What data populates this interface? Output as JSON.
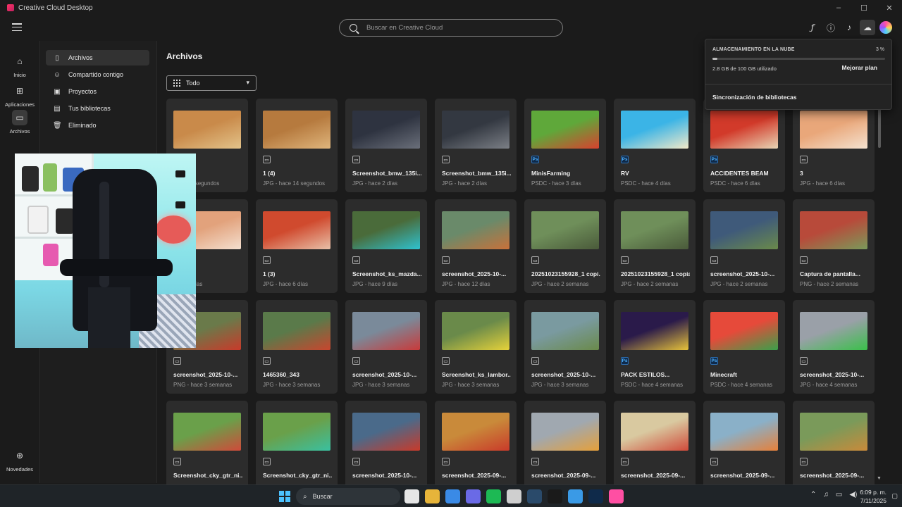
{
  "window": {
    "title": "Creative Cloud Desktop",
    "controls": [
      "minimize",
      "maximize",
      "close"
    ]
  },
  "search": {
    "placeholder": "Buscar en Creative Cloud"
  },
  "top_icons": [
    "fonts-icon",
    "help-icon",
    "bell-icon",
    "cloud-icon",
    "avatar"
  ],
  "rail": {
    "items": [
      {
        "label": "Inicio",
        "icon": "home-icon"
      },
      {
        "label": "Aplicaciones",
        "icon": "apps-icon"
      },
      {
        "label": "Archivos",
        "icon": "files-icon",
        "active": true
      },
      {
        "label": "Novedades",
        "icon": "gift-icon"
      }
    ]
  },
  "sidenav": {
    "items": [
      {
        "label": "Archivos",
        "icon": "file-icon",
        "active": true
      },
      {
        "label": "Compartido contigo",
        "icon": "people-icon"
      },
      {
        "label": "Proyectos",
        "icon": "project-icon"
      },
      {
        "label": "Tus bibliotecas",
        "icon": "library-icon"
      },
      {
        "label": "Eliminado",
        "icon": "trash-icon"
      }
    ]
  },
  "main": {
    "title": "Archivos",
    "filter_label": "Todo"
  },
  "files": [
    {
      "name": "",
      "meta": "hace 12 segundos",
      "type": "img",
      "colors": [
        "#c98a4a",
        "#e3c38a"
      ]
    },
    {
      "name": "1 (4)",
      "meta": "JPG - hace 14 segundos",
      "type": "img",
      "colors": [
        "#b67a3e",
        "#dfb57c"
      ]
    },
    {
      "name": "Screenshot_bmw_135i...",
      "meta": "JPG - hace 2 días",
      "type": "img",
      "colors": [
        "#2e3340",
        "#6a6f7a"
      ]
    },
    {
      "name": "Screenshot_bmw_135i...",
      "meta": "JPG - hace 2 días",
      "type": "img",
      "colors": [
        "#333841",
        "#7b7f86"
      ]
    },
    {
      "name": "MinisFarming",
      "meta": "PSDC - hace 3 días",
      "type": "ps",
      "colors": [
        "#5fa83a",
        "#d8412f"
      ]
    },
    {
      "name": "RV",
      "meta": "PSDC - hace 4 días",
      "type": "ps",
      "colors": [
        "#3bb4e6",
        "#f2e9c9"
      ]
    },
    {
      "name": "ACCIDENTES BEAM",
      "meta": "PSDC - hace 6 días",
      "type": "ps",
      "colors": [
        "#d23a2a",
        "#e7d5b5"
      ]
    },
    {
      "name": "3",
      "meta": "JPG - hace 6 días",
      "type": "img",
      "colors": [
        "#e9a77a",
        "#f5e2d0"
      ]
    },
    {
      "name": "",
      "meta": "hace 6 días",
      "type": "img",
      "colors": [
        "#e2a27c",
        "#f4dfcf"
      ]
    },
    {
      "name": "1 (3)",
      "meta": "JPG - hace 6 días",
      "type": "img",
      "colors": [
        "#d04a2e",
        "#e8c0a8"
      ]
    },
    {
      "name": "Screenshot_ks_mazda...",
      "meta": "JPG - hace 9 días",
      "type": "img",
      "colors": [
        "#4a6b3a",
        "#2fc2d0"
      ]
    },
    {
      "name": "screenshot_2025-10-...",
      "meta": "JPG - hace 12 días",
      "type": "img",
      "colors": [
        "#6a8a6a",
        "#c9713a"
      ]
    },
    {
      "name": "20251023155928_1 copi...",
      "meta": "JPG - hace 2 semanas",
      "type": "img",
      "colors": [
        "#6f8f5a",
        "#4a5a3a"
      ]
    },
    {
      "name": "20251023155928_1 copia",
      "meta": "JPG - hace 2 semanas",
      "type": "img",
      "colors": [
        "#6f8f5a",
        "#4a5a3a"
      ]
    },
    {
      "name": "screenshot_2025-10-...",
      "meta": "JPG - hace 2 semanas",
      "type": "img",
      "colors": [
        "#3f5a7a",
        "#6a8a4a"
      ]
    },
    {
      "name": "Captura de pantalla...",
      "meta": "PNG - hace 2 semanas",
      "type": "img",
      "colors": [
        "#b84a3a",
        "#7a9a5a"
      ]
    },
    {
      "name": "screenshot_2025-10-...",
      "meta": "PNG - hace 3 semanas",
      "type": "img",
      "colors": [
        "#6a7a4a",
        "#c93a2a"
      ]
    },
    {
      "name": "1465360_343",
      "meta": "JPG - hace 3 semanas",
      "type": "img",
      "colors": [
        "#5a7a4a",
        "#c9462e"
      ]
    },
    {
      "name": "screenshot_2025-10-...",
      "meta": "JPG - hace 3 semanas",
      "type": "img",
      "colors": [
        "#7a8a9a",
        "#c93a3a"
      ]
    },
    {
      "name": "Screenshot_ks_lambor...",
      "meta": "JPG - hace 3 semanas",
      "type": "img",
      "colors": [
        "#6a8a4a",
        "#e6d23a"
      ]
    },
    {
      "name": "screenshot_2025-10-...",
      "meta": "JPG - hace 3 semanas",
      "type": "img",
      "colors": [
        "#7a9aa0",
        "#6a8a4a"
      ]
    },
    {
      "name": "PACK ESTILOS...",
      "meta": "PSDC - hace 4 semanas",
      "type": "ps",
      "colors": [
        "#2a1a4a",
        "#e6c23a"
      ]
    },
    {
      "name": "Minecraft",
      "meta": "PSDC - hace 4 semanas",
      "type": "ps",
      "colors": [
        "#e64a3a",
        "#3aa04a"
      ]
    },
    {
      "name": "screenshot_2025-10-...",
      "meta": "JPG - hace 4 semanas",
      "type": "img",
      "colors": [
        "#9aa0a8",
        "#3ac04a"
      ]
    },
    {
      "name": "Screenshot_cky_gtr_ni...",
      "meta": "",
      "type": "img",
      "colors": [
        "#6aa04a",
        "#d04a3a"
      ]
    },
    {
      "name": "Screenshot_cky_gtr_ni...",
      "meta": "",
      "type": "img",
      "colors": [
        "#6aa04a",
        "#3ac0a0"
      ]
    },
    {
      "name": "screenshot_2025-10-...",
      "meta": "",
      "type": "img",
      "colors": [
        "#4a6a8a",
        "#c93a2a"
      ]
    },
    {
      "name": "screenshot_2025-09-...",
      "meta": "",
      "type": "img",
      "colors": [
        "#c98a3a",
        "#c93a2a"
      ]
    },
    {
      "name": "screenshot_2025-09-...",
      "meta": "",
      "type": "img",
      "colors": [
        "#a0a8b0",
        "#e6a03a"
      ]
    },
    {
      "name": "screenshot_2025-09-...",
      "meta": "",
      "type": "img",
      "colors": [
        "#d9c9a0",
        "#d04a3a"
      ]
    },
    {
      "name": "screenshot_2025-09-...",
      "meta": "",
      "type": "img",
      "colors": [
        "#8ab0c8",
        "#e6803a"
      ]
    },
    {
      "name": "screenshot_2025-09-...",
      "meta": "",
      "type": "img",
      "colors": [
        "#7a9a5a",
        "#c98a3a"
      ]
    }
  ],
  "cloud_popover": {
    "title": "ALMACENAMIENTO EN LA NUBE",
    "percent": "3 %",
    "used_fraction": 0.03,
    "usage": "2.8 GB de 100 GB utilizado",
    "upgrade": "Mejorar plan",
    "sync": "Sincronización de bibliotecas"
  },
  "taskbar": {
    "search_label": "Buscar",
    "time": "6:09 p. m.",
    "date": "7/11/2025",
    "apps": [
      "#e6e6e6",
      "#e6b43a",
      "#3a8ae6",
      "#6a6ae6",
      "#1db954",
      "#cfcfcf",
      "#2a4a6a",
      "#1a1a1a",
      "#3a9ae6",
      "#0f2a4a",
      "#ff4fa3"
    ]
  },
  "accent": "#4fb3ff"
}
